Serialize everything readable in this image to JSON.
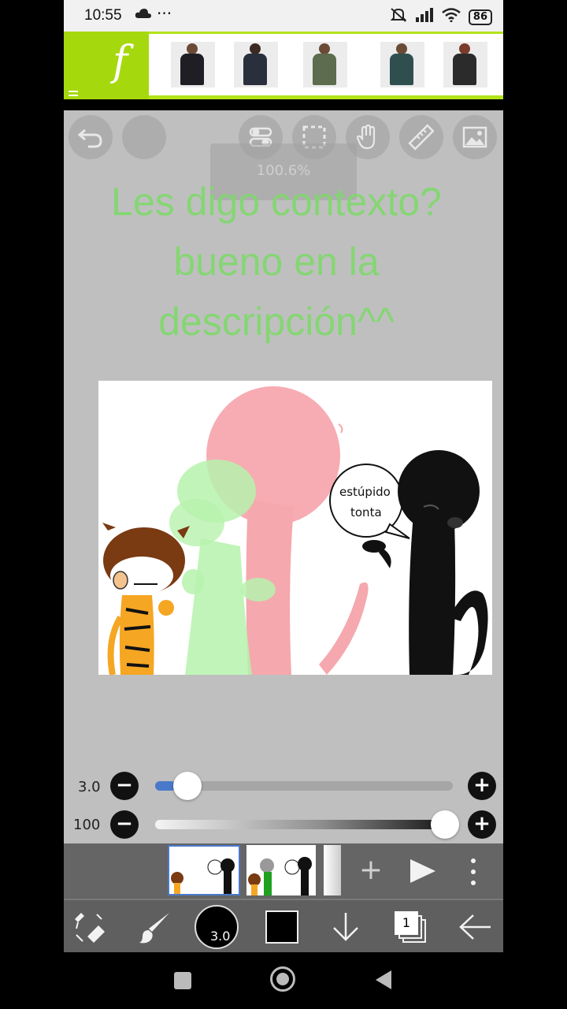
{
  "status_bar": {
    "time": "10:55",
    "more": "···",
    "battery": "86"
  },
  "ad_banner": {
    "logo_text": "f",
    "items": [
      "product-thumb-1",
      "product-thumb-2",
      "product-thumb-3",
      "product-thumb-4",
      "product-thumb-5"
    ]
  },
  "top_toolbar": {
    "zoom_label": "100.6%"
  },
  "overlay_text": {
    "line1": "Les digo contexto?",
    "line2": "bueno en la",
    "line3": "descripción^^"
  },
  "drawing": {
    "speech_line1": "estúpido",
    "speech_line2": "tonta"
  },
  "brush_size": {
    "label": "3.0",
    "value_fraction": 0.07
  },
  "opacity": {
    "label": "100",
    "value_fraction": 1.0
  },
  "layers": {
    "add_label": "+",
    "count": "1"
  },
  "bottom_toolbar": {
    "brush_size_badge": "3.0",
    "colors": {
      "current": "#000000",
      "accent": "#b2e31a",
      "slider_fill": "#4a79c9"
    }
  }
}
